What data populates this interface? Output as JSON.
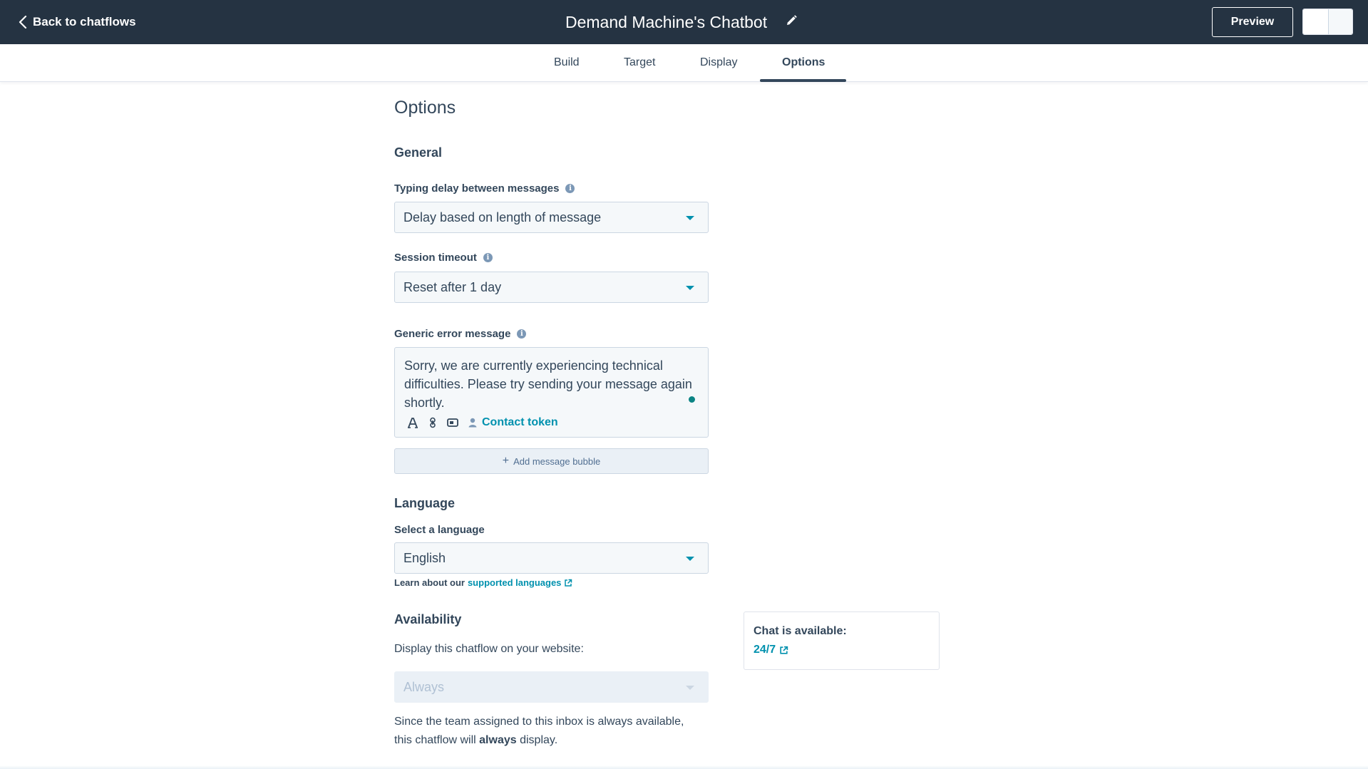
{
  "header": {
    "back_label": "Back to chatflows",
    "title": "Demand Machine's Chatbot",
    "preview_label": "Preview"
  },
  "tabs": [
    {
      "label": "Build"
    },
    {
      "label": "Target"
    },
    {
      "label": "Display"
    },
    {
      "label": "Options",
      "active": true
    }
  ],
  "main": {
    "title": "Options",
    "general": {
      "heading": "General",
      "typing_delay": {
        "label": "Typing delay between messages",
        "value": "Delay based on length of message"
      },
      "session_timeout": {
        "label": "Session timeout",
        "value": "Reset after 1 day"
      },
      "error_message": {
        "label": "Generic error message",
        "value": "Sorry, we are currently experiencing technical difficulties. Please try sending your message again shortly.",
        "contact_token": "Contact token"
      },
      "add_bubble": "Add message bubble"
    },
    "language": {
      "heading": "Language",
      "label": "Select a language",
      "value": "English",
      "help_prefix": "Learn about our",
      "help_link": "supported languages"
    },
    "availability": {
      "heading": "Availability",
      "label": "Display this chatflow on your website:",
      "value": "Always",
      "note_prefix": "Since the team assigned to this inbox is always available, this chatflow will",
      "note_bold": "always",
      "note_suffix": "display.",
      "card_label": "Chat is available:",
      "card_link": "24/7"
    }
  },
  "colors": {
    "header_bg": "#253342",
    "accent_link": "#0091ae",
    "text": "#33475b"
  },
  "icons": [
    "chevron-left-icon",
    "pencil-icon",
    "info-icon",
    "caret-down-icon",
    "text-style-icon",
    "link-icon",
    "video-icon",
    "person-icon",
    "plus-icon",
    "external-link-icon"
  ]
}
